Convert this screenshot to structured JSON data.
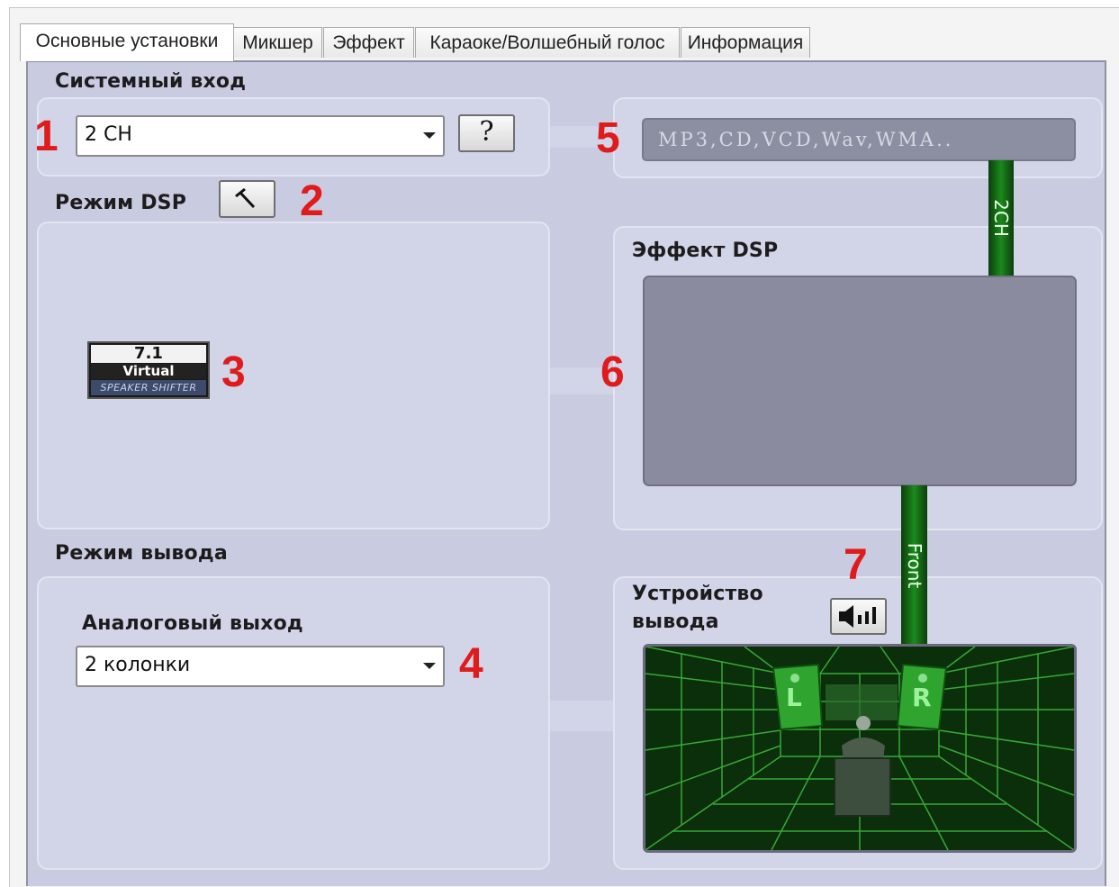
{
  "tabs": [
    "Основные установки",
    "Микшер",
    "Эффект",
    "Караоке/Волшебный голос",
    "Информация"
  ],
  "system_input": {
    "title": "Системный вход",
    "channel_value": "2 CH",
    "help_label": "?",
    "formats": "MP3,CD,VCD,Wav,WMA.."
  },
  "dsp_mode": {
    "title": "Режим DSP"
  },
  "logo": {
    "top": "7.1",
    "middle": "Virtual",
    "bottom": "SPEAKER SHIFTER"
  },
  "dsp_effect": {
    "title": "Эффект DSP"
  },
  "output_mode": {
    "title": "Режим вывода",
    "analog_label": "Аналоговый выход",
    "speakers_value": "2 колонки"
  },
  "output_device": {
    "title_line1": "Устройство",
    "title_line2": "вывода"
  },
  "channels": {
    "top": "2CH",
    "front": "Front"
  },
  "speaker_labels": {
    "left": "L",
    "right": "R"
  },
  "callouts": [
    "1",
    "2",
    "3",
    "4",
    "5",
    "6",
    "7"
  ],
  "colors": {
    "callout": "#e01b1b",
    "panel": "#c9cbe0",
    "green": "#1b8a1b"
  }
}
